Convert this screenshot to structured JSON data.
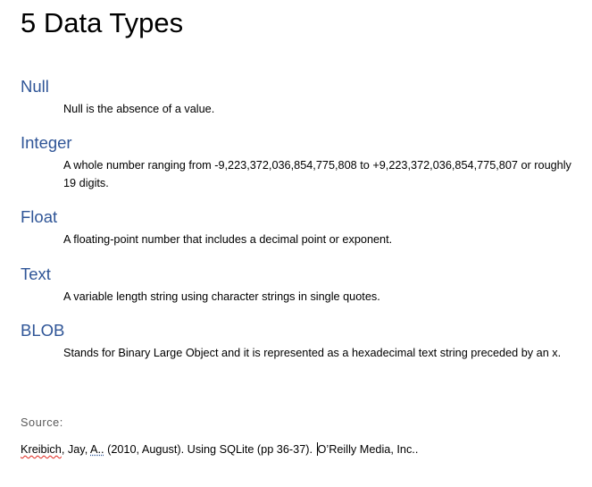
{
  "document": {
    "title": "5 Data Types",
    "sections": [
      {
        "heading": "Null",
        "description": "Null is the absence of a value."
      },
      {
        "heading": "Integer",
        "description": "A whole number ranging from -9,223,372,036,854,775,808 to +9,223,372,036,854,775,807 or roughly 19 digits."
      },
      {
        "heading": "Float",
        "description": "A floating-point number that includes a decimal point or exponent."
      },
      {
        "heading": "Text",
        "description": "A variable length string using character strings in single quotes."
      },
      {
        "heading": "BLOB",
        "description": "Stands for Binary Large Object and it is represented as a hexadecimal text string preceded by an x."
      }
    ],
    "source_label": "Source:",
    "citation": {
      "author_last": "Kreibich",
      "sep1": ", Jay, ",
      "initial": "A..",
      "rest_before_caret": " (2010, August). Using SQLite (pp 36-37). ",
      "rest_after_caret": "O’Reilly Media, Inc.."
    }
  },
  "colors": {
    "heading": "#2f5597",
    "source_label": "#595959",
    "spellcheck": "#e0241b"
  }
}
